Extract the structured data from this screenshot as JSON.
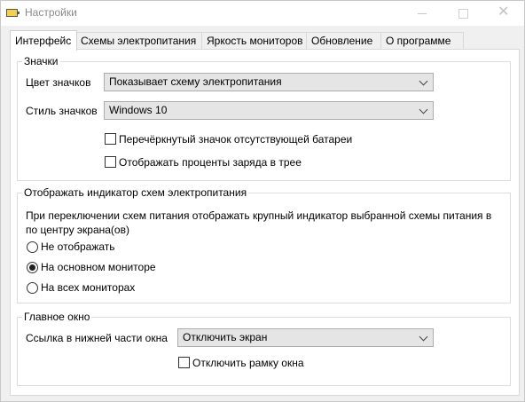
{
  "window": {
    "title": "Настройки",
    "close_glyph": "✕"
  },
  "tabs": [
    {
      "label": "Интерфейс",
      "active": true
    },
    {
      "label": "Схемы электропитания"
    },
    {
      "label": "Яркость мониторов"
    },
    {
      "label": "Обновление"
    },
    {
      "label": "О программе"
    }
  ],
  "icons_group": {
    "title": "Значки",
    "icon_color": {
      "label": "Цвет значков",
      "value": "Показывает схему электропитания"
    },
    "icon_style": {
      "label": "Стиль значков",
      "value": "Windows 10"
    },
    "crossed_battery": {
      "label": "Перечёркнутый значок отсутствующей батареи",
      "checked": false
    },
    "show_percent": {
      "label": "Отображать проценты заряда в трее",
      "checked": false
    }
  },
  "indicator_group": {
    "title": "Отображать индикатор схем электропитания",
    "description": "При переключении схем питания отображать крупный индикатор выбранной схемы питания в по центру экрана(ов)",
    "options": [
      {
        "label": "Не отображать",
        "selected": false
      },
      {
        "label": "На основном мониторе",
        "selected": true
      },
      {
        "label": "На всех мониторах",
        "selected": false
      }
    ]
  },
  "main_window_group": {
    "title": "Главное окно",
    "bottom_link": {
      "label": "Ссылка в нижней части окна",
      "value": "Отключить экран"
    },
    "disable_frame": {
      "label": "Отключить рамку окна",
      "checked": false
    }
  }
}
